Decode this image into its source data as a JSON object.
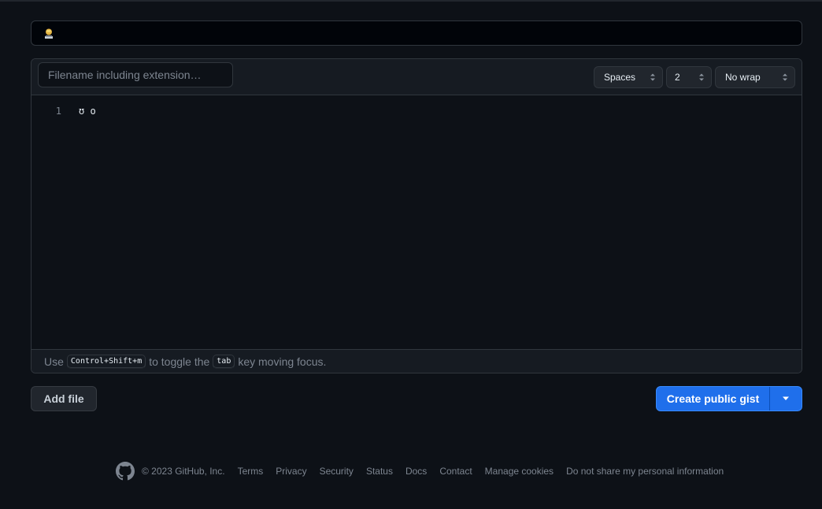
{
  "description": {
    "icon": "avatar-icon",
    "value": ""
  },
  "editor": {
    "filename_placeholder": "Filename including extension…",
    "indent_mode": "Spaces",
    "indent_size": "2",
    "wrap_mode": "No wrap",
    "lines": [
      {
        "number": "1",
        "text": "ʊ o"
      }
    ],
    "hint": {
      "prefix": "Use",
      "shortcut": "Control+Shift+m",
      "middle": "to toggle the",
      "key": "tab",
      "suffix": "key moving focus."
    }
  },
  "actions": {
    "add_file": "Add file",
    "create": "Create public gist",
    "accent_color": "#1f6feb"
  },
  "footer": {
    "copyright": "© 2023 GitHub, Inc.",
    "links": [
      "Terms",
      "Privacy",
      "Security",
      "Status",
      "Docs",
      "Contact",
      "Manage cookies",
      "Do not share my personal information"
    ]
  }
}
